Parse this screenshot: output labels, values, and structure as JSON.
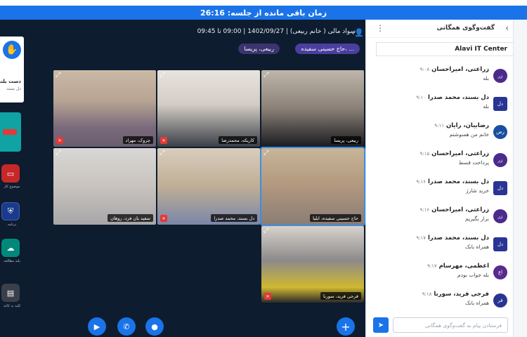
{
  "timer": {
    "label": "زمان باقی مانده از جلسه: 26:16"
  },
  "meeting": {
    "info": "سواد مالی ( خانم ربیعی) | 1402/09/27 | 09:00 تا 09:45",
    "speakers": [
      "حاج حسینی سفیده، ...",
      "ربیعی، پریسا"
    ]
  },
  "sidebar": {
    "hand_title": "دست بلند",
    "hand_sub": "دل بسند",
    "apps": [
      {
        "label": "موضوع کار",
        "icon": "slides-icon"
      },
      {
        "label": "برنامه",
        "icon": "shield-icon"
      },
      {
        "label": "بلند مطالعه",
        "icon": "cloud-icon"
      },
      {
        "label": "کلید به کاغذ",
        "icon": "doc-icon"
      }
    ]
  },
  "participants": [
    {
      "name": "چروک، مهراد",
      "muted": true
    },
    {
      "name": "کاریکه، محمدرضا",
      "muted": true
    },
    {
      "name": "ربیعی، پریسا",
      "muted": false
    },
    {
      "name": "سعید یان فرد، روهان",
      "muted": false
    },
    {
      "name": "دل بسند، محمد صدرا",
      "muted": true
    },
    {
      "name": "حاج حسینی سفیده، ایلیا",
      "muted": false
    },
    {
      "name": "فرجی فرید، سورنا",
      "muted": true
    }
  ],
  "chat": {
    "title": "گفت‌وگوی همگانی",
    "pinned": "Alavi IT Center",
    "input_placeholder": "فرستادن پیام به گفت‌وگوی همگانی",
    "messages": [
      {
        "initials": "زر",
        "name": "زراعتی، امیراحسان",
        "time": "۹:۰۸",
        "text": "بله",
        "color": "#4b2a8c"
      },
      {
        "initials": "دل",
        "name": "دل بسند، محمد صدرا",
        "time": "۹:۱۰",
        "text": "بله",
        "color": "#283593"
      },
      {
        "initials": "رض",
        "name": "رضاییان، رایان",
        "time": "۹:۱۱",
        "text": "خانم من همنوشتم",
        "color": "#1a4fa0"
      },
      {
        "initials": "زر",
        "name": "زراعتی، امیراحسان",
        "time": "۹:۱۵",
        "text": "پرداخت قسط",
        "color": "#4b2a8c"
      },
      {
        "initials": "دل",
        "name": "دل بسند، محمد صدرا",
        "time": "۹:۱۶",
        "text": "خرید شارژ",
        "color": "#283593"
      },
      {
        "initials": "زر",
        "name": "زراعتی، امیراحسان",
        "time": "۹:۱۶",
        "text": "بزار بگیریم",
        "color": "#4b2a8c"
      },
      {
        "initials": "دل",
        "name": "دل بسند، محمد صدرا",
        "time": "۹:۱۷",
        "text": "همراه بانک",
        "color": "#283593"
      },
      {
        "initials": "اع",
        "name": "اعظمی، مهرسام",
        "time": "۹:۱۷",
        "text": "بله جواب بودم",
        "color": "#5a2a8c"
      },
      {
        "initials": "فر",
        "name": "فرجی فرید، سورنا",
        "time": "۹:۱۸",
        "text": "همراه بانک",
        "color": "#283593"
      }
    ]
  },
  "controls": [
    "camera-icon",
    "phone-icon",
    "mic-icon",
    "plus-icon"
  ]
}
